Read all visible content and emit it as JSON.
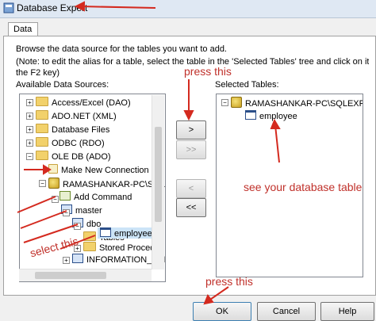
{
  "window": {
    "title": "Database Expert"
  },
  "tabs": [
    {
      "label": "Data"
    }
  ],
  "instructions": {
    "line1": "Browse the data source for the tables you want to add.",
    "line2": "(Note: to edit the alias for a table, select the table in the 'Selected Tables' tree and click on it or press",
    "line3": "the F2 key)"
  },
  "available": {
    "label": "Available Data Sources:",
    "items": [
      {
        "label": "Access/Excel (DAO)"
      },
      {
        "label": "ADO.NET (XML)"
      },
      {
        "label": "Database Files"
      },
      {
        "label": "ODBC (RDO)"
      },
      {
        "label": "OLE DB (ADO)"
      },
      {
        "label": "Make New Connection"
      },
      {
        "label": "RAMASHANKAR-PC\\SQLE"
      },
      {
        "label": "Add Command"
      },
      {
        "label": "master"
      },
      {
        "label": "dbo"
      },
      {
        "label": "Tables"
      },
      {
        "label": "employee"
      },
      {
        "label": "Stored Procedur"
      },
      {
        "label": "INFORMATION_SCI"
      }
    ]
  },
  "selected": {
    "label": "Selected Tables:",
    "items": [
      {
        "label": "RAMASHANKAR-PC\\SQLEXPRES"
      },
      {
        "label": "employee"
      }
    ]
  },
  "buttons": {
    "add": ">",
    "add_all": ">>",
    "remove": "<",
    "remove_all": "<<",
    "ok": "OK",
    "cancel": "Cancel",
    "help": "Help"
  },
  "annotations": {
    "press_this_top": "press this",
    "select_this": "select this",
    "see_table": "see your database table",
    "press_this_bottom": "press this"
  },
  "colors": {
    "annotation": "#c0312b"
  }
}
